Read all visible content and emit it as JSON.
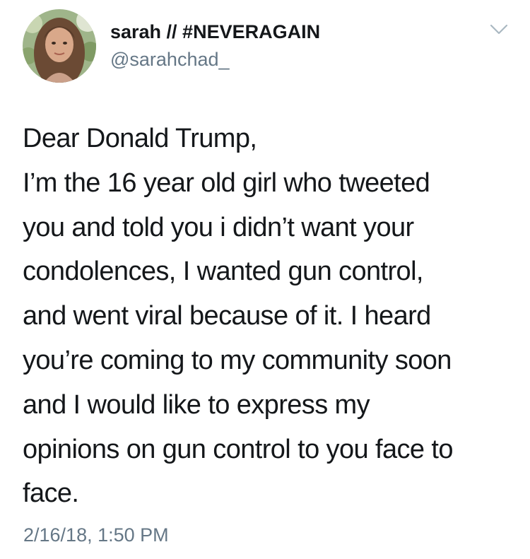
{
  "tweet": {
    "display_name": "sarah // #NEVERAGAIN",
    "handle": "@sarahchad_",
    "body_lines": [
      "Dear Donald Trump,",
      "I’m the 16 year old girl who tweeted",
      "you and told you i didn’t want your",
      "condolences, I wanted gun control,",
      "and went viral because of it. I heard",
      "you’re coming to my community soon",
      "and I would like to express my",
      "opinions on gun control to you face to",
      "face."
    ],
    "timestamp": "2/16/18, 1:50 PM"
  },
  "icons": {
    "avatar": "profile-photo",
    "menu": "chevron-down-icon"
  },
  "colors": {
    "text_primary": "#14171a",
    "text_secondary": "#657786",
    "chevron": "#aab8c2",
    "background": "#ffffff"
  }
}
